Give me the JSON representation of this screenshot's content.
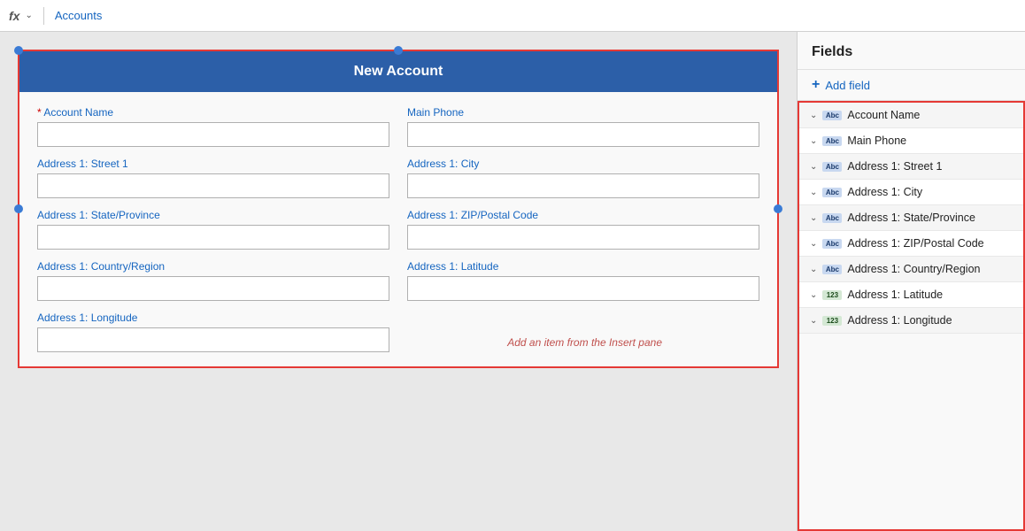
{
  "topbar": {
    "fx_label": "fx",
    "chevron": "∨",
    "breadcrumb": "Accounts"
  },
  "form": {
    "title": "New Account",
    "fields": [
      {
        "id": "account-name",
        "label": "Account Name",
        "required": true,
        "col": 1,
        "row": 1
      },
      {
        "id": "main-phone",
        "label": "Main Phone",
        "required": false,
        "col": 2,
        "row": 1
      },
      {
        "id": "address-street",
        "label": "Address 1: Street 1",
        "required": false,
        "col": 1,
        "row": 2
      },
      {
        "id": "address-city",
        "label": "Address 1: City",
        "required": false,
        "col": 2,
        "row": 2
      },
      {
        "id": "address-state",
        "label": "Address 1: State/Province",
        "required": false,
        "col": 1,
        "row": 3
      },
      {
        "id": "address-zip",
        "label": "Address 1: ZIP/Postal Code",
        "required": false,
        "col": 2,
        "row": 3
      },
      {
        "id": "address-country",
        "label": "Address 1: Country/Region",
        "required": false,
        "col": 1,
        "row": 4
      },
      {
        "id": "address-lat",
        "label": "Address 1: Latitude",
        "required": false,
        "col": 2,
        "row": 4
      },
      {
        "id": "address-lon",
        "label": "Address 1: Longitude",
        "required": false,
        "col": 1,
        "row": 5
      }
    ],
    "insert_hint": "Add an item from the Insert pane"
  },
  "sidebar": {
    "title": "Fields",
    "add_field_label": "+ Add field",
    "items": [
      {
        "id": "account-name",
        "label": "Account Name",
        "icon": "Abc",
        "type": "text"
      },
      {
        "id": "main-phone",
        "label": "Main Phone",
        "icon": "Abc",
        "type": "text"
      },
      {
        "id": "address-street1",
        "label": "Address 1: Street 1",
        "icon": "Abc",
        "type": "text"
      },
      {
        "id": "address-city",
        "label": "Address 1: City",
        "icon": "Abc",
        "type": "text"
      },
      {
        "id": "address-state",
        "label": "Address 1: State/Province",
        "icon": "Abc",
        "type": "text"
      },
      {
        "id": "address-zip",
        "label": "Address 1: ZIP/Postal Code",
        "icon": "Abc",
        "type": "text"
      },
      {
        "id": "address-country",
        "label": "Address 1: Country/Region",
        "icon": "Abc",
        "type": "text"
      },
      {
        "id": "address-lat",
        "label": "Address 1: Latitude",
        "icon": "123",
        "type": "numeric"
      },
      {
        "id": "address-lon",
        "label": "Address 1: Longitude",
        "icon": "123",
        "type": "numeric"
      }
    ]
  }
}
